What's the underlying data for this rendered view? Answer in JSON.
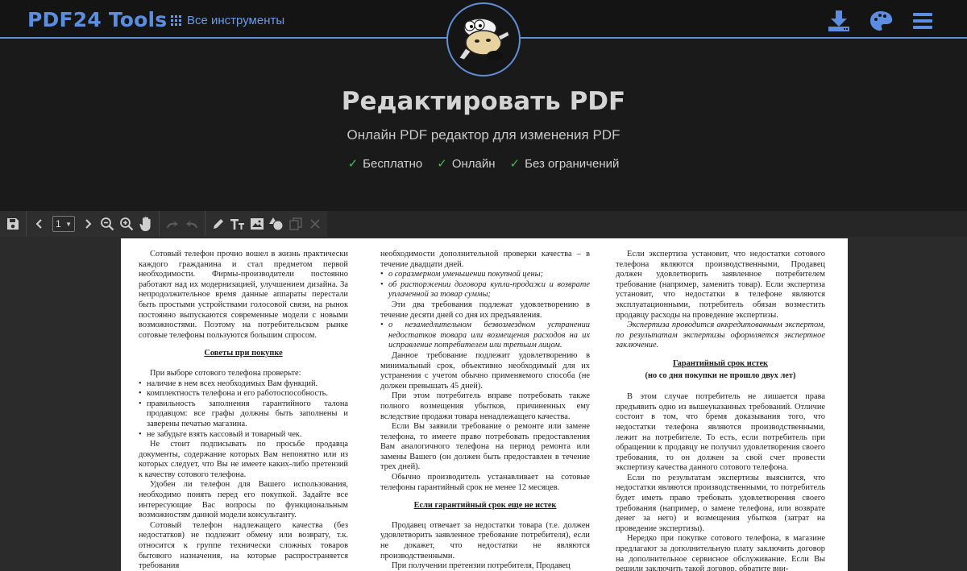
{
  "header": {
    "brand": "PDF24 Tools",
    "all_tools": "Все инструменты",
    "icons": [
      "download-icon",
      "palette-icon",
      "menu-icon"
    ]
  },
  "hero": {
    "title": "Редактировать PDF",
    "subtitle": "Онлайн PDF редактор для изменения PDF",
    "features": [
      "Бесплатно",
      "Онлайн",
      "Без ограничений"
    ],
    "check": "✓"
  },
  "toolbar": {
    "page_value": "1",
    "icons": [
      "save-icon",
      "prev-page-icon",
      "page-select",
      "next-page-icon",
      "zoom-out-icon",
      "zoom-in-icon",
      "hand-icon",
      "redo-icon",
      "undo-icon",
      "pen-icon",
      "text-icon",
      "image-icon",
      "shapes-icon",
      "copy-icon",
      "delete-icon"
    ]
  },
  "document": {
    "col1": {
      "p1": "Сотовый телефон прочно вошел в жизнь практически каждого гражданина и стал предметом первой необходимости. Фирмы-производители постоянно работают над их модернизацией, улучшением дизайна. За непродолжительное время данные аппараты перестали быть простыми устройствами голосовой связи, на рынок постоянно выпускаются современные модели с новыми возможностями. Поэтому на потребительском рынке сотовые телефоны пользуются большим спросом.",
      "head": "Советы при покупке",
      "p2": "При выборе сотового телефона проверьте:",
      "li1": "наличие в нем всех необходимых Вам функций.",
      "li2": "комплектность телефона и его работоспособность.",
      "li3": "правильность заполнения гарантийного талона продавцом: все графы должны быть заполнены и заверены печатью магазина.",
      "li4": "не забудьте взять кассовый и товарный чек.",
      "p3": "Не стоит подписывать по просьбе продавца документы, содержание которых Вам непонятно или из которых следует, что Вы не имеете каких-либо претензий к качеству сотового телефона.",
      "p4": "Удобен ли телефон для Вашего использования, необходимо понять перед его покупкой. Задайте все интересующие Вас вопросы по функциональным возможностям данной модели консультанту.",
      "p5": "Сотовый телефон надлежащего качества (без недостатков) не подлежит обмену или возврату, т.к. относится к группе технически сложных товаров бытового назначения, на которые распространяется требования"
    },
    "col2": {
      "p1": "необходимости дополнительной проверки качества – в течение двадцати дней.",
      "li1": "о соразмерном уменьшении покупной цены;",
      "li2": "об расторжении договора купли-продажи и возврате уплаченной за товар суммы;",
      "p2": "Эти два требования подлежат удовлетворению в течение десяти дней со дня их предъявления.",
      "li3": "о незамедлительном безвозмездном устранении недостатков товара или возмещения расходов на их исправление потребителем или третьим лицом.",
      "p3": "Данное требование подлежит удовлетворению в минимальный срок, объективно необходимый для их устранения с учетом обычно применяемого способа (не должен превышать 45 дней).",
      "p4": "При этом потребитель вправе потребовать также полного возмещения убытков, причиненных ему вследствие продажи товара ненадлежащего качества.",
      "p5": "Если Вы заявили требование о ремонте или замене телефона, то имеете право потребовать предоставления Вам аналогичного телефона на период ремонта или замены Вашего (он должен быть предоставлен в течение трех дней).",
      "p6": "Обычно производитель устанавливает на сотовые телефоны гарантийный срок не менее 12 месяцев.",
      "head": "Если гарантийный срок еще не истек",
      "p7": "Продавец отвечает за недостатки товара (т.е. должен удовлетворить заявленное требование потребителя), если не докажет, что недостатки не являются производственными.",
      "p8": "При получении претензии потребителя, Продавец"
    },
    "col3": {
      "p1": "Если экспертиза установит, что недостатки сотового телефона являются производственными, Продавец должен удовлетворить заявленное потребителем требование (например, заменить товар). Если экспертиза установит, что недостатки в телефоне являются эксплуатационными, потребитель обязан возместить продавцу расходы на проведение экспертизы.",
      "p2": "Экспертиза проводится аккредитованным экспертом, по результатам экспертизы оформляется экспертное заключение.",
      "head": "Гарантийный срок истек",
      "head_sub": "(но со дня покупки не прошло двух лет)",
      "p3": "В этом случае потребитель не лишается права предъявить одно из вышеуказанных требований. Отличие состоит в том, что бремя доказывания того, что недостатки телефона являются производственными, лежит на потребителе. То есть, если потребитель при обращении к продавцу не получил удовлетворения своего требования, то он должен за свой счет провести экспертизу качества данного сотового телефона.",
      "p4": "Если по результатам экспертизы выяснится, что недостатки являются производственными, то потребитель будет иметь право требовать удовлетворения своего требования (например, о замене телефона, или возврате денег за него) и возмещения убытков (затрат на проведение экспертизы).",
      "p5": "Нередко при покупке сотового телефона, в магазине предлагают за дополнительную плату заключить договор на дополнительное сервисное обслуживание. Если Вы решили заключить такой договор, обратите вни-"
    }
  }
}
